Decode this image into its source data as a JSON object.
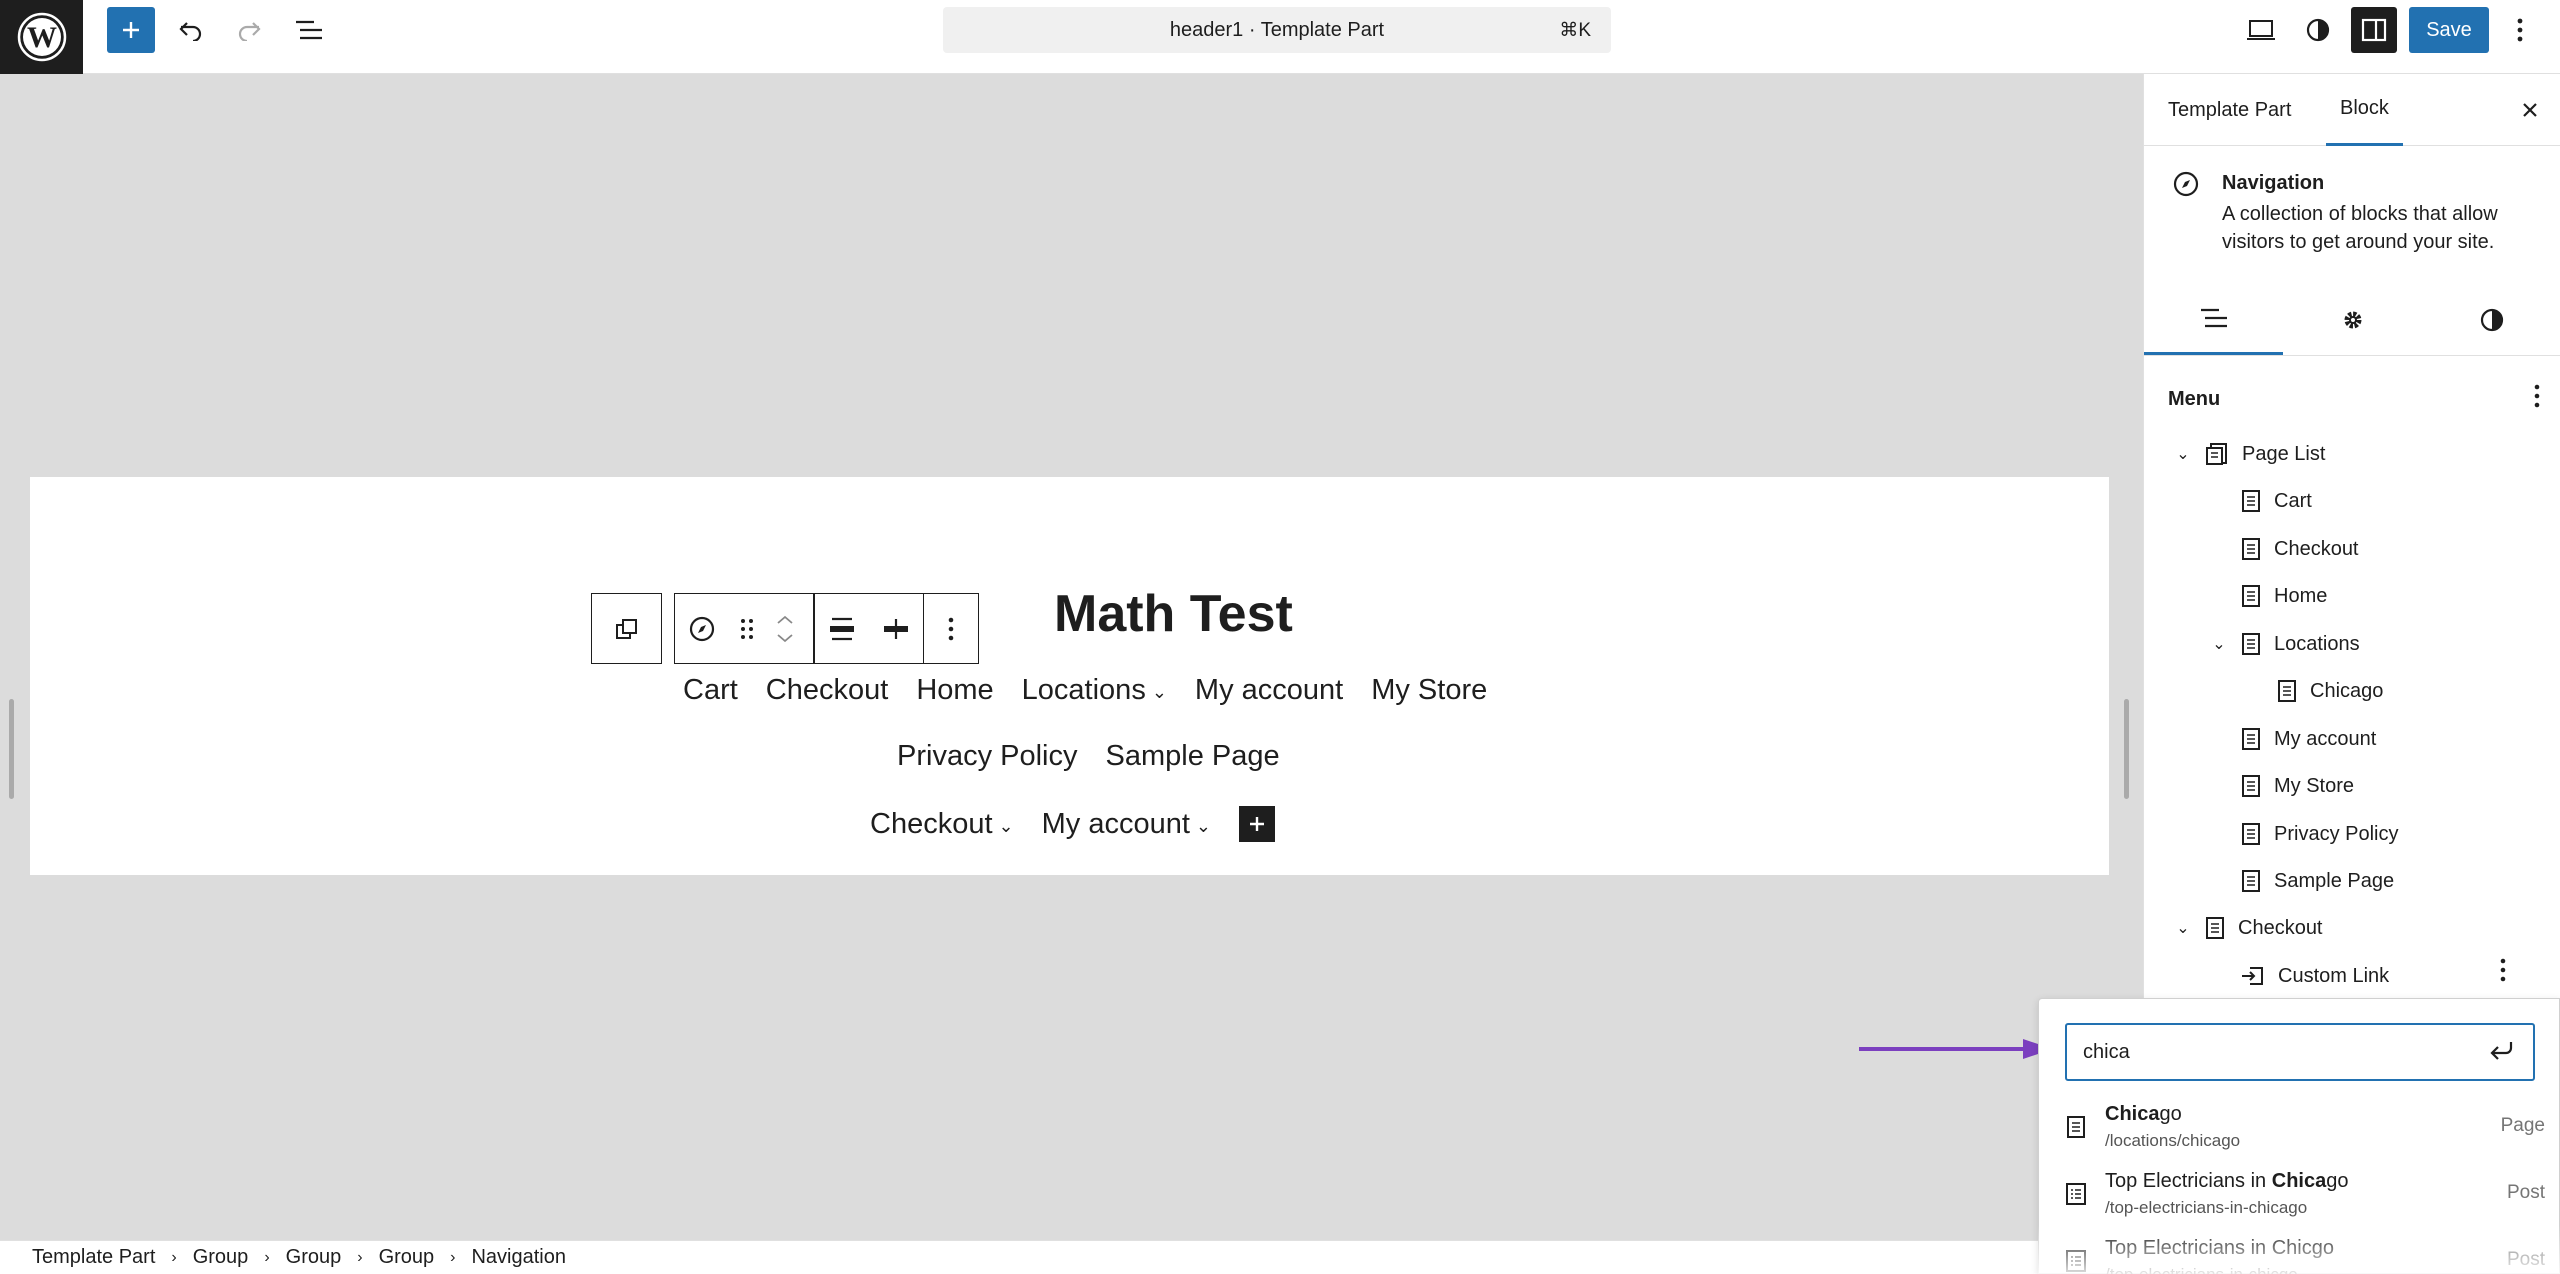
{
  "topbar": {
    "document_title": "header1 · Template Part",
    "shortcut": "⌘K",
    "save_label": "Save"
  },
  "canvas": {
    "site_title": "Math Test",
    "nav_rows": [
      [
        {
          "label": "Cart",
          "submenu": false
        },
        {
          "label": "Checkout",
          "submenu": false
        },
        {
          "label": "Home",
          "submenu": false
        },
        {
          "label": "Locations",
          "submenu": true
        },
        {
          "label": "My account",
          "submenu": false
        },
        {
          "label": "My Store",
          "submenu": false
        }
      ],
      [
        {
          "label": "Privacy Policy",
          "submenu": false
        },
        {
          "label": "Sample Page",
          "submenu": false
        }
      ],
      [
        {
          "label": "Checkout",
          "submenu": true
        },
        {
          "label": "My account",
          "submenu": true
        }
      ]
    ]
  },
  "breadcrumbs": [
    "Template Part",
    "Group",
    "Group",
    "Group",
    "Navigation"
  ],
  "sidebar": {
    "tabs": [
      "Template Part",
      "Block"
    ],
    "active_tab": "Block",
    "block": {
      "name": "Navigation",
      "description": "A collection of blocks that allow visitors to get around your site."
    },
    "menu_heading": "Menu",
    "tree": [
      {
        "label": "Page List",
        "level": 0,
        "expanded": true,
        "icon": "page-list-icon"
      },
      {
        "label": "Cart",
        "level": 1,
        "icon": "page-icon"
      },
      {
        "label": "Checkout",
        "level": 1,
        "icon": "page-icon"
      },
      {
        "label": "Home",
        "level": 1,
        "icon": "page-icon"
      },
      {
        "label": "Locations",
        "level": 1,
        "expanded": true,
        "icon": "page-icon"
      },
      {
        "label": "Chicago",
        "level": 2,
        "icon": "page-icon"
      },
      {
        "label": "My account",
        "level": 1,
        "icon": "page-icon"
      },
      {
        "label": "My Store",
        "level": 1,
        "icon": "page-icon"
      },
      {
        "label": "Privacy Policy",
        "level": 1,
        "icon": "page-icon"
      },
      {
        "label": "Sample Page",
        "level": 1,
        "icon": "page-icon"
      },
      {
        "label": "Checkout",
        "level": 0,
        "expanded": true,
        "icon": "page-icon"
      },
      {
        "label": "Custom Link",
        "level": 1,
        "icon": "custom-link-icon"
      }
    ]
  },
  "link_popover": {
    "search_value": "chica",
    "suggestions": [
      {
        "title_bold": "Chica",
        "title_rest": "go",
        "title_prefix": "",
        "url": "/locations/chicago",
        "type": "Page"
      },
      {
        "title_prefix": "Top Electricians in ",
        "title_bold": "Chica",
        "title_rest": "go",
        "url": "/top-electricians-in-chicago",
        "type": "Post"
      },
      {
        "title_prefix": "Top Electricians in Chicgo",
        "title_bold": "",
        "title_rest": "",
        "url": "/top-electricians-in-chicgo",
        "type": "Post"
      }
    ]
  },
  "colors": {
    "accent": "#2271b1",
    "dark": "#1e1e1e",
    "canvas_bg": "#dcdcdc",
    "annotation_arrow": "#7b3fbf"
  }
}
